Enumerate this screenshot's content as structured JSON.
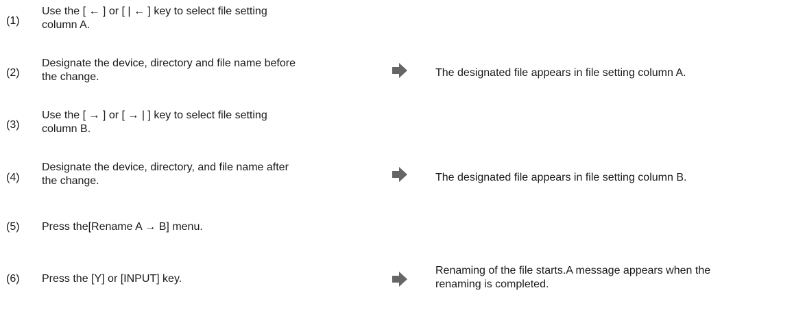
{
  "steps": [
    {
      "num": "(1)",
      "line1": "Use the [ ← ] or [ | ← ] key to select file setting",
      "line2": "column A.",
      "result": null,
      "arrow_icon": null
    },
    {
      "num": "(2)",
      "line1": "Designate the device, directory and file name before",
      "line2": "the change.",
      "result": "The designated file appears in file setting column A.",
      "arrow_icon": "right-arrow-icon"
    },
    {
      "num": "(3)",
      "line1": "Use the [ → ] or [ → | ] key to select file setting",
      "line2": "column B.",
      "result": null,
      "arrow_icon": null
    },
    {
      "num": "(4)",
      "line1": "Designate the device, directory, and file name after",
      "line2": "the change.",
      "result": "The designated file appears in file setting column B.",
      "arrow_icon": "right-arrow-icon"
    },
    {
      "num": "(5)",
      "line1": "Press the[Rename A → B] menu.",
      "line2": null,
      "result": null,
      "arrow_icon": null
    },
    {
      "num": "(6)",
      "line1": "Press the [Y] or [INPUT]  key.",
      "line2": null,
      "result_line1": "Renaming of the file starts.A message appears when the",
      "result_line2": "renaming is completed.",
      "arrow_icon": "right-arrow-icon"
    }
  ],
  "colors": {
    "text": "#1a1a1a",
    "arrow": "#666666"
  }
}
